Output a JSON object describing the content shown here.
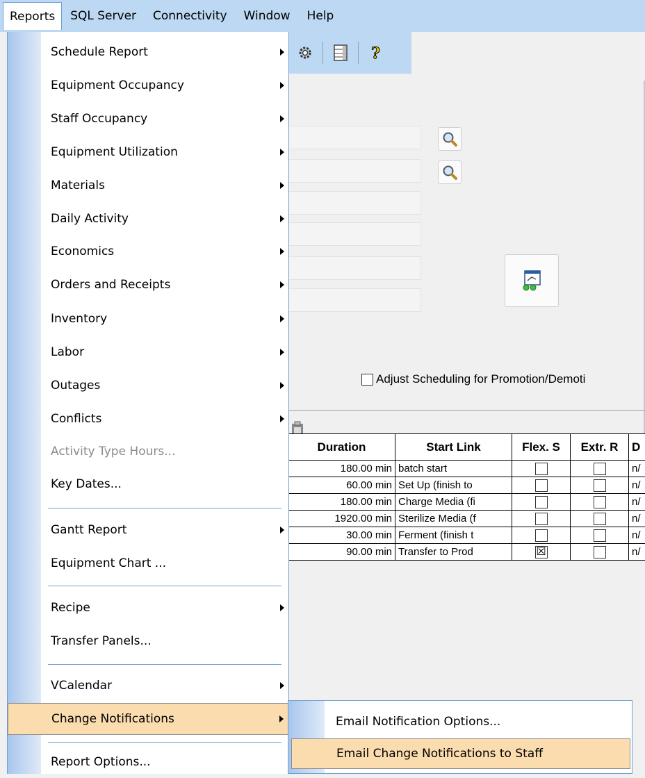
{
  "menubar": {
    "items": [
      "Reports",
      "SQL Server",
      "Connectivity",
      "Window",
      "Help"
    ]
  },
  "toolbar": {
    "icons": [
      "gear-icon",
      "database-icon",
      "help-icon"
    ]
  },
  "form": {
    "adjust_label": "Adjust Scheduling for Promotion/Demoti"
  },
  "grid": {
    "columns": [
      "Duration",
      "Start Link",
      "Flex. S",
      "Extr. R",
      "D"
    ],
    "rows": [
      {
        "duration": "180.00 min",
        "start_link": "batch start",
        "flex": "",
        "extr": "",
        "d": "n/"
      },
      {
        "duration": "60.00 min",
        "start_link": "Set Up (finish to",
        "flex": "",
        "extr": "",
        "d": "n/"
      },
      {
        "duration": "180.00 min",
        "start_link": "Charge Media (fi",
        "flex": "",
        "extr": "",
        "d": "n/"
      },
      {
        "duration": "1920.00 min",
        "start_link": "Sterilize Media (f",
        "flex": "",
        "extr": "",
        "d": "n/"
      },
      {
        "duration": "30.00 min",
        "start_link": "Ferment (finish t",
        "flex": "",
        "extr": "",
        "d": "n/"
      },
      {
        "duration": "90.00 min",
        "start_link": "Transfer to Prod",
        "flex": "☒",
        "extr": "",
        "d": "n/"
      }
    ]
  },
  "menu": {
    "items": [
      {
        "label": "Schedule Report"
      },
      {
        "label": "Equipment Occupancy"
      },
      {
        "label": "Staff Occupancy"
      },
      {
        "label": "Equipment Utilization"
      },
      {
        "label": "Materials"
      },
      {
        "label": "Daily Activity"
      },
      {
        "label": "Economics"
      },
      {
        "label": "Orders and Receipts"
      },
      {
        "label": "Inventory"
      },
      {
        "label": "Labor"
      },
      {
        "label": "Outages"
      },
      {
        "label": "Conflicts"
      },
      {
        "label": "Activity Type Hours..."
      },
      {
        "label": "Key Dates..."
      },
      {
        "label": "Gantt Report"
      },
      {
        "label": "Equipment Chart ..."
      },
      {
        "label": "Recipe"
      },
      {
        "label": "Transfer Panels..."
      },
      {
        "label": "VCalendar"
      },
      {
        "label": "Change Notifications"
      },
      {
        "label": "Report Options..."
      }
    ]
  },
  "submenu": {
    "items": [
      {
        "label": "Email Notification Options..."
      },
      {
        "label": "Email Change Notifications to Staff"
      }
    ]
  },
  "colors": {
    "menubar_bg": "#bcd8f2",
    "highlight_bg": "#fbdcaf",
    "menu_border": "#6f9fd1"
  }
}
